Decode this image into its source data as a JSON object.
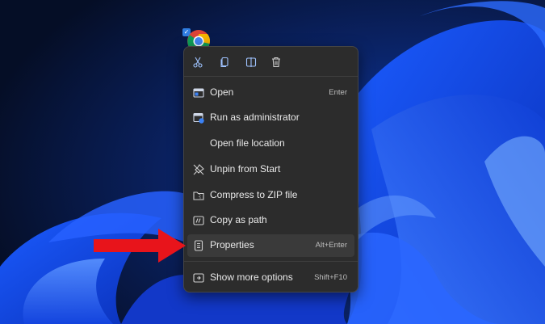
{
  "desktop": {
    "shortcut_icon": "chrome-icon",
    "selected_check": "✓"
  },
  "context_menu": {
    "quick_actions": [
      {
        "icon": "cut-icon"
      },
      {
        "icon": "copy-icon"
      },
      {
        "icon": "rename-icon"
      },
      {
        "icon": "delete-icon"
      }
    ],
    "items": [
      {
        "label": "Open",
        "shortcut": "Enter",
        "icon": "open-window-icon"
      },
      {
        "label": "Run as administrator",
        "shortcut": "",
        "icon": "shield-admin-icon"
      },
      {
        "label": "Open file location",
        "shortcut": "",
        "icon": ""
      },
      {
        "label": "Unpin from Start",
        "shortcut": "",
        "icon": "unpin-icon"
      },
      {
        "label": "Compress to ZIP file",
        "shortcut": "",
        "icon": "zip-folder-icon"
      },
      {
        "label": "Copy as path",
        "shortcut": "",
        "icon": "copy-path-icon"
      },
      {
        "label": "Properties",
        "shortcut": "Alt+Enter",
        "icon": "properties-icon"
      },
      {
        "label": "Show more options",
        "shortcut": "Shift+F10",
        "icon": "more-options-icon"
      }
    ]
  },
  "annotation": {
    "color": "#e8141b",
    "icon": "red-arrow"
  },
  "colors": {
    "menu_bg": "#2c2c2c",
    "accent": "#2f7de1",
    "text": "#e9e9e9"
  }
}
